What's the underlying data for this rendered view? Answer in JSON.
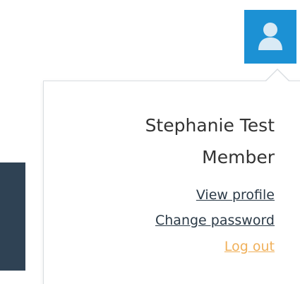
{
  "header": {
    "user_icon": "user-icon",
    "accent_color": "#1c91d4"
  },
  "dropdown": {
    "user_name": "Stephanie Test",
    "user_role": "Member",
    "links": {
      "view_profile": "View profile",
      "change_password": "Change password",
      "log_out": "Log out"
    },
    "logout_color": "#f0b05a"
  }
}
